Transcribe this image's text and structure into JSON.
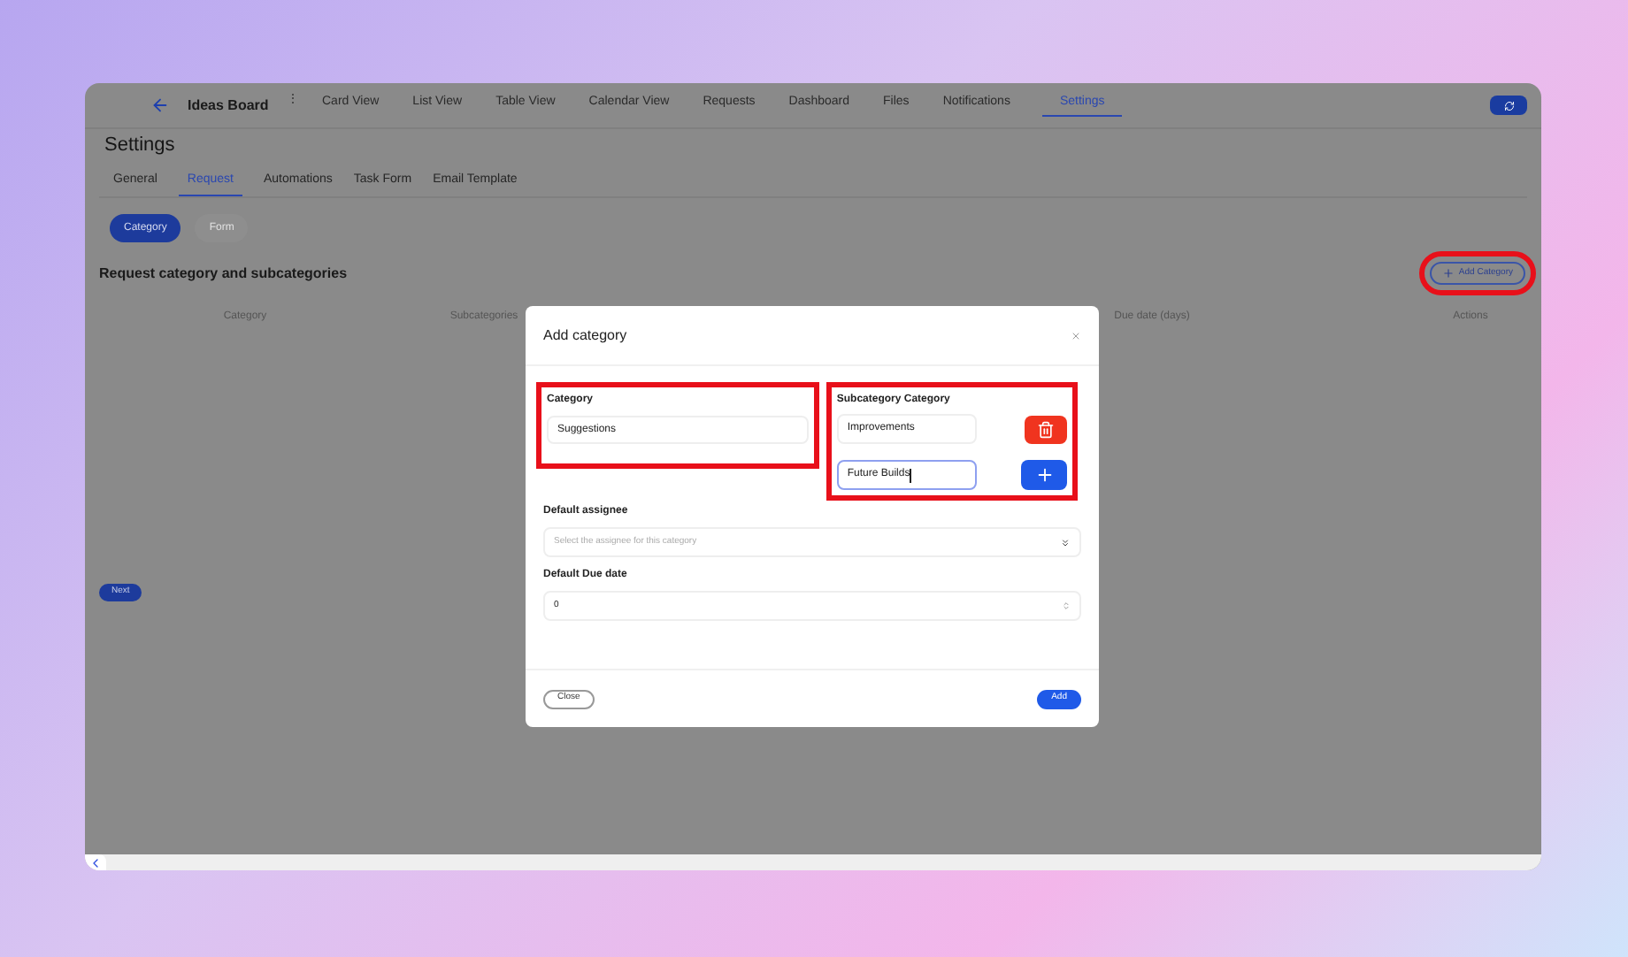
{
  "header": {
    "title": "Ideas Board",
    "menu_glyph": "⋮",
    "nav": [
      {
        "label": "Card View",
        "selected": false
      },
      {
        "label": "List View",
        "selected": false
      },
      {
        "label": "Table View",
        "selected": false
      },
      {
        "label": "Calendar View",
        "selected": false
      },
      {
        "label": "Requests",
        "selected": false
      },
      {
        "label": "Dashboard",
        "selected": false
      },
      {
        "label": "Files",
        "selected": false
      },
      {
        "label": "Notifications",
        "selected": false
      },
      {
        "label": "Settings",
        "selected": true
      }
    ]
  },
  "page": {
    "title": "Settings",
    "tabs": [
      {
        "label": "General",
        "selected": false
      },
      {
        "label": "Request",
        "selected": true
      },
      {
        "label": "Automations",
        "selected": false
      },
      {
        "label": "Task Form",
        "selected": false
      },
      {
        "label": "Email Template",
        "selected": false
      }
    ],
    "subtabs": [
      {
        "label": "Category",
        "selected": true
      },
      {
        "label": "Form",
        "selected": false
      }
    ],
    "section_title": "Request category and subcategories",
    "add_button": {
      "label": "Add Category",
      "highlighted": true
    },
    "table": {
      "columns": [
        "Category",
        "Subcategories",
        "Due date (days)",
        "Actions"
      ]
    },
    "next_button": "Next"
  },
  "dialog": {
    "title": "Add category",
    "category": {
      "label": "Category",
      "value": "Suggestions",
      "highlighted": true
    },
    "subcategory": {
      "label": "Subcategory Category",
      "highlighted": true,
      "items": [
        {
          "value": "Improvements",
          "kind": "saved",
          "focused": false
        },
        {
          "value": "Future Builds",
          "kind": "new",
          "focused": true
        }
      ]
    },
    "assignee": {
      "label": "Default assignee",
      "placeholder": "Select the assignee for this category"
    },
    "due_date": {
      "label": "Default Due date",
      "value": "0"
    },
    "close_button": "Close",
    "add_button": "Add"
  }
}
